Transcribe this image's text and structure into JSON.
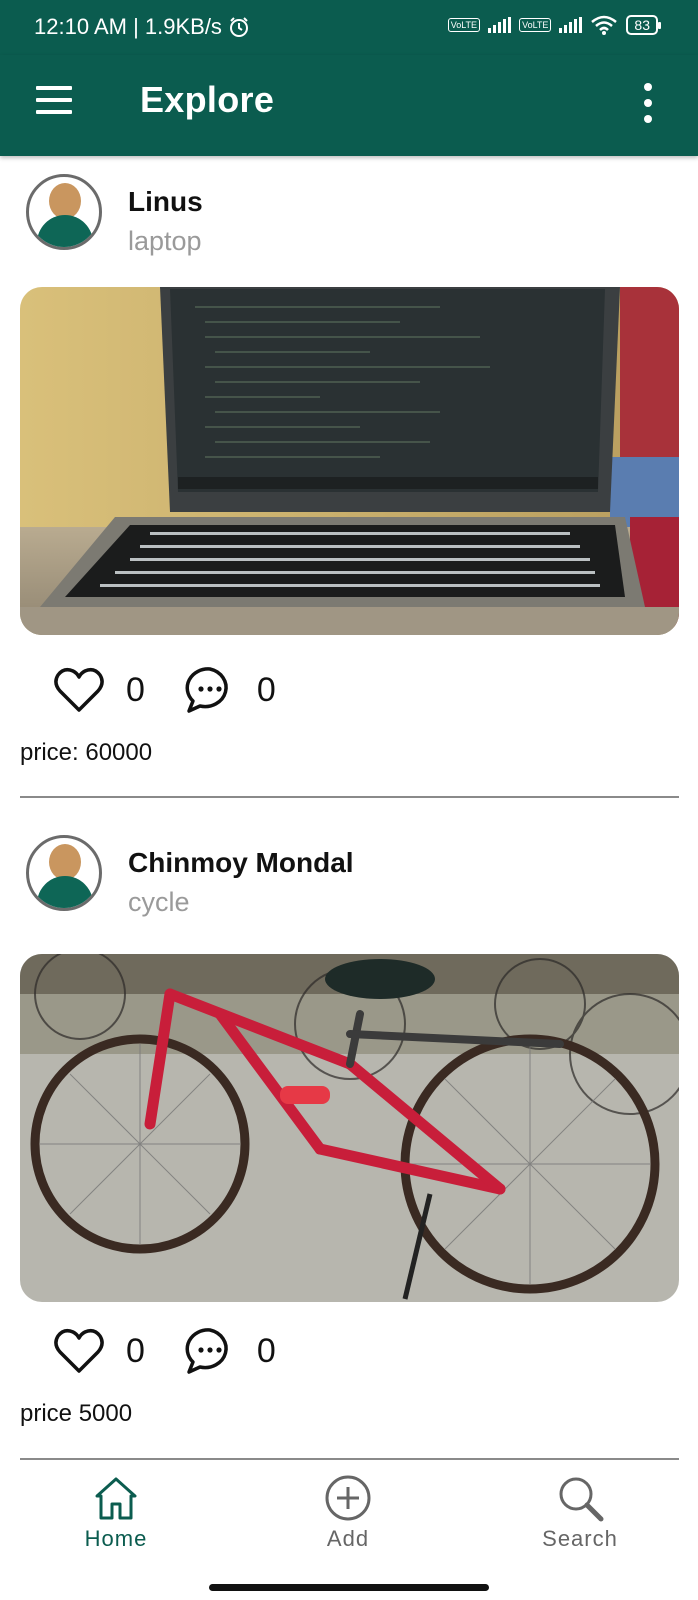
{
  "status_bar": {
    "time_speed": "12:10 AM | 1.9KB/s",
    "volte_label": "Vo LTE",
    "battery": "83"
  },
  "app_bar": {
    "title": "Explore"
  },
  "posts": [
    {
      "user": "Linus",
      "item": "laptop",
      "likes": "0",
      "comments": "0",
      "price": "price: 60000",
      "image": "laptop-photo"
    },
    {
      "user": "Chinmoy Mondal",
      "item": "cycle",
      "likes": "0",
      "comments": "0",
      "price": "price 5000",
      "image": "bicycle-photo"
    }
  ],
  "bottom_nav": {
    "items": [
      {
        "label": "Home",
        "icon": "home-icon",
        "active": true
      },
      {
        "label": "Add",
        "icon": "add-circle-icon",
        "active": false
      },
      {
        "label": "Search",
        "icon": "search-icon",
        "active": false
      }
    ]
  },
  "colors": {
    "primary": "#0b5c4f",
    "active_nav": "#0b5c4f",
    "inactive_nav": "#666666",
    "secondary_text": "#9a9a9a"
  }
}
